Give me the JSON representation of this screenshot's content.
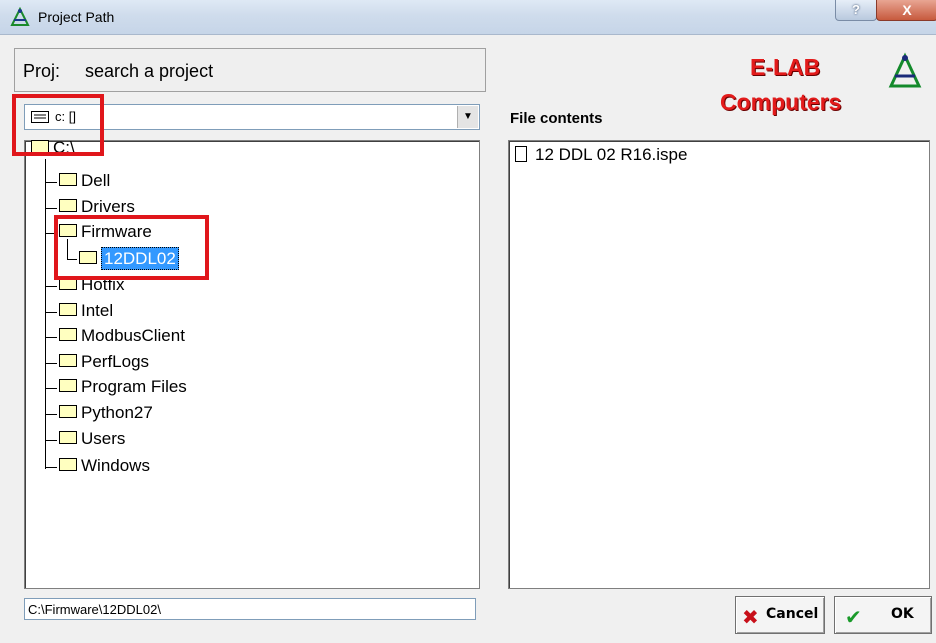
{
  "window": {
    "title": "Project Path",
    "help_glyph": "?",
    "close_glyph": "X"
  },
  "project": {
    "label": "Proj:",
    "value": "search a project"
  },
  "brand": {
    "line1": "E-LAB",
    "line2": "Computers"
  },
  "drive_select": {
    "value": "c: []"
  },
  "file_contents": {
    "header": "File contents",
    "files": [
      "12 DDL 02 R16.ispe"
    ]
  },
  "tree": {
    "root": "C:\\",
    "items": [
      "Dell",
      "Drivers",
      "Firmware",
      "Hotfix",
      "Intel",
      "ModbusClient",
      "PerfLogs",
      "Program Files",
      "Python27",
      "Users",
      "Windows"
    ],
    "selected_child": "12DDL02"
  },
  "path_field": {
    "value": "C:\\Firmware\\12DDL02\\"
  },
  "buttons": {
    "cancel": "Cancel",
    "ok": "OK"
  },
  "colors": {
    "highlight_box": "#e0161b",
    "brand_red": "#e31b1b",
    "selection_blue": "#3399ff"
  }
}
